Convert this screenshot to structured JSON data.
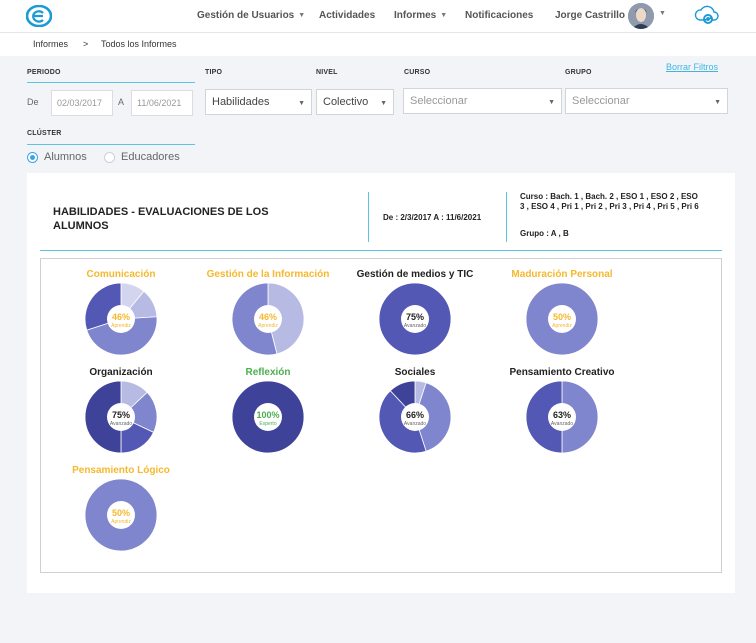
{
  "header": {
    "nav": [
      {
        "label": "Gestión de Usuarios",
        "caret": true
      },
      {
        "label": "Actividades",
        "caret": false
      },
      {
        "label": "Informes",
        "caret": true
      },
      {
        "label": "Notificaciones",
        "caret": false
      }
    ],
    "user_name": "Jorge Castrillo",
    "brand_color": "#1c9ad6"
  },
  "breadcrumb": {
    "root": "Informes",
    "separator": ">",
    "current": "Todos los Informes"
  },
  "filters": {
    "periodo_label": "PERIODO",
    "tipo_label": "TIPO",
    "nivel_label": "NIVEL",
    "curso_label": "CURSO",
    "grupo_label": "GRUPO",
    "cluster_label": "CLÚSTER",
    "clear_label": "Borrar Filtros",
    "from_label": "De",
    "to_label": "A",
    "date_from": "02/03/2017",
    "date_to": "11/06/2021",
    "tipo_value": "Habilidades",
    "nivel_value": "Colectivo",
    "curso_placeholder": "Seleccionar",
    "grupo_placeholder": "Seleccionar",
    "cluster_options": [
      {
        "label": "Alumnos",
        "selected": true
      },
      {
        "label": "Educadores",
        "selected": false
      }
    ]
  },
  "report": {
    "title": "HABILIDADES - EVALUACIONES DE LOS ALUMNOS",
    "dates": "De : 2/3/2017 A : 11/6/2021",
    "course": "Curso : Bach. 1 , Bach. 2 , ESO 1 , ESO 2 , ESO 3 , ESO 4 , Pri 1 , Pri 2 , Pri 3 , Pri 4 , Pri 5 , Pri 6",
    "group": "Grupo : A , B",
    "accent_color": "#5bc4e4"
  },
  "chart_data": {
    "type": "pie",
    "charts": [
      {
        "title": "Comunicación",
        "percent": "46%",
        "level": "Aprendiz",
        "label_color": "#f5b82e",
        "slices": [
          {
            "value": 11,
            "color": "#d3d5ef"
          },
          {
            "value": 13,
            "color": "#b7bbe4"
          },
          {
            "value": 46,
            "color": "#7f86cd"
          },
          {
            "value": 30,
            "color": "#5258b4"
          }
        ]
      },
      {
        "title": "Gestión de la Información",
        "percent": "46%",
        "level": "Aprendiz",
        "label_color": "#f5b82e",
        "slices": [
          {
            "value": 46,
            "color": "#b7bbe4"
          },
          {
            "value": 54,
            "color": "#7f86cd"
          }
        ]
      },
      {
        "title": "Gestión de medios y TIC",
        "percent": "75%",
        "level": "Avanzado",
        "label_color": "#222222",
        "slices": [
          {
            "value": 100,
            "color": "#5258b4"
          }
        ]
      },
      {
        "title": "Maduración Personal",
        "percent": "50%",
        "level": "Aprendiz",
        "label_color": "#f5b82e",
        "slices": [
          {
            "value": 100,
            "color": "#7f86cd"
          }
        ]
      },
      {
        "title": "Organización",
        "percent": "75%",
        "level": "Avanzado",
        "label_color": "#222222",
        "slices": [
          {
            "value": 13,
            "color": "#b7bbe4"
          },
          {
            "value": 19,
            "color": "#7f86cd"
          },
          {
            "value": 18,
            "color": "#5258b4"
          },
          {
            "value": 50,
            "color": "#3e4399"
          }
        ]
      },
      {
        "title": "Reflexión",
        "percent": "100%",
        "level": "Experto",
        "label_color": "#4caf50",
        "slices": [
          {
            "value": 100,
            "color": "#3e4399"
          }
        ]
      },
      {
        "title": "Sociales",
        "percent": "66%",
        "level": "Avanzado",
        "label_color": "#222222",
        "slices": [
          {
            "value": 5,
            "color": "#b7bbe4"
          },
          {
            "value": 40,
            "color": "#7f86cd"
          },
          {
            "value": 43,
            "color": "#5258b4"
          },
          {
            "value": 12,
            "color": "#3e4399"
          }
        ]
      },
      {
        "title": "Pensamiento Creativo",
        "percent": "63%",
        "level": "Avanzado",
        "label_color": "#222222",
        "slices": [
          {
            "value": 50,
            "color": "#7f86cd"
          },
          {
            "value": 50,
            "color": "#5258b4"
          }
        ]
      },
      {
        "title": "Pensamiento Lógico",
        "percent": "50%",
        "level": "Aprendiz",
        "label_color": "#f5b82e",
        "slices": [
          {
            "value": 100,
            "color": "#7f86cd"
          }
        ]
      }
    ]
  }
}
